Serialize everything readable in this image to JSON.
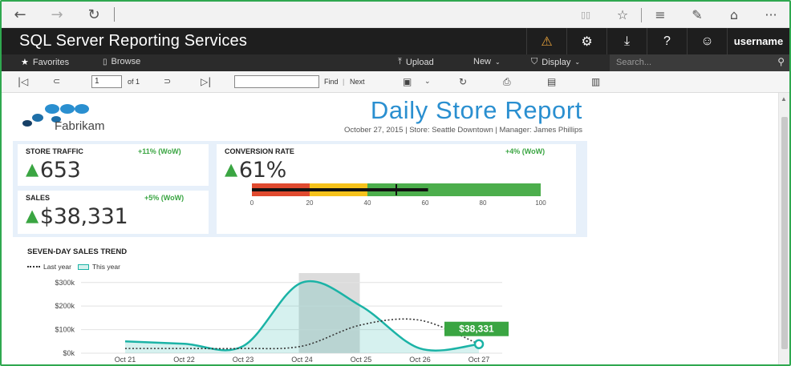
{
  "browser": {
    "back_icon": "←",
    "forward_icon": "→",
    "refresh_icon": "↻",
    "reading_icon": "▯▯",
    "favorite_icon": "☆",
    "hub_icon": "≡",
    "note_icon": "✎",
    "share_icon": "⌂",
    "more_icon": "···"
  },
  "header": {
    "title": "SQL Server Reporting Services",
    "warning_icon": "⚠",
    "settings_icon": "⚙",
    "download_icon": "⤓",
    "help_icon": "?",
    "smiley_icon": "☺",
    "username": "username"
  },
  "menu": {
    "favorites": "Favorites",
    "browse": "Browse",
    "upload": "Upload",
    "new": "New",
    "display": "Display",
    "search_placeholder": "Search..."
  },
  "toolbar": {
    "page_value": "1",
    "of_label": "of 1",
    "find_label": "Find",
    "next_label": "Next"
  },
  "report": {
    "title": "Daily Store Report",
    "brand": "Fabrikam",
    "subtitle": "October 27, 2015  |  Store: Seattle Downtown  |  Manager: James Phillips",
    "kpis": {
      "store_traffic": {
        "label": "STORE TRAFFIC",
        "change": "+11% (WoW)",
        "value": "653"
      },
      "conversion_rate": {
        "label": "CONVERSION RATE",
        "change": "+4% (WoW)",
        "value": "61%"
      },
      "sales": {
        "label": "SALES",
        "change": "+5% (WoW)",
        "value": "$38,331"
      }
    },
    "bullet": {
      "ticks": [
        "0",
        "20",
        "40",
        "60",
        "80",
        "100"
      ],
      "ranges": [
        {
          "from": 0,
          "to": 20,
          "color": "#e04a2f"
        },
        {
          "from": 20,
          "to": 40,
          "color": "#f6c21b"
        },
        {
          "from": 40,
          "to": 100,
          "color": "#4cae4c"
        }
      ],
      "value": 61,
      "target": 50
    },
    "trend": {
      "title": "SEVEN-DAY SALES TREND",
      "legend_last": "Last year",
      "legend_this": "This year",
      "callout": "$38,331"
    }
  },
  "chart_data": {
    "type": "area",
    "title": "SEVEN-DAY SALES TREND",
    "categories": [
      "Oct 21",
      "Oct 22",
      "Oct 23",
      "Oct 24",
      "Oct 25",
      "Oct 26",
      "Oct 27"
    ],
    "y_ticks": [
      "$0k",
      "$100k",
      "$200k",
      "$300k"
    ],
    "ylim": [
      0,
      340000
    ],
    "highlight_category": "Oct 24",
    "series": [
      {
        "name": "This year",
        "style": "area",
        "color": "#1bb3a6",
        "values": [
          50000,
          40000,
          30000,
          300000,
          200000,
          20000,
          38331
        ]
      },
      {
        "name": "Last year",
        "style": "dotted",
        "color": "#333333",
        "values": [
          20000,
          20000,
          20000,
          30000,
          120000,
          140000,
          38331
        ]
      }
    ],
    "annotations": [
      {
        "category": "Oct 27",
        "label": "$38,331"
      }
    ]
  }
}
